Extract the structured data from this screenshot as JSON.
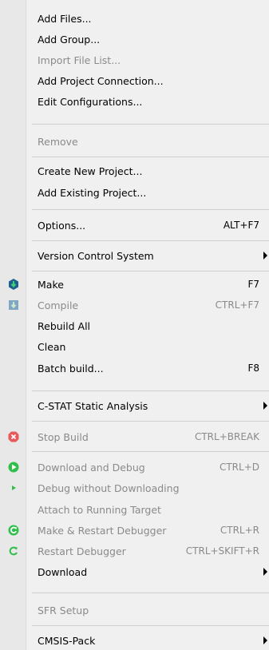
{
  "menu": {
    "items": [
      {
        "label": "Add Files...",
        "enabled": true
      },
      {
        "label": "Add Group...",
        "enabled": true
      },
      {
        "label": "Import File List...",
        "enabled": false
      },
      {
        "label": "Add Project Connection...",
        "enabled": true
      },
      {
        "label": "Edit Configurations...",
        "enabled": true
      },
      {
        "label": "Remove",
        "enabled": false
      },
      {
        "label": "Create New Project...",
        "enabled": true
      },
      {
        "label": "Add Existing Project...",
        "enabled": true
      },
      {
        "label": "Options...",
        "shortcut": "ALT+F7",
        "enabled": true
      },
      {
        "label": "Version Control System",
        "submenu": true,
        "enabled": true
      },
      {
        "label": "Make",
        "shortcut": "F7",
        "icon": "make-icon",
        "enabled": true
      },
      {
        "label": "Compile",
        "shortcut": "CTRL+F7",
        "icon": "compile-icon",
        "enabled": false
      },
      {
        "label": "Rebuild All",
        "enabled": true
      },
      {
        "label": "Clean",
        "enabled": true
      },
      {
        "label": "Batch build...",
        "shortcut": "F8",
        "enabled": true
      },
      {
        "label": "C-STAT Static Analysis",
        "submenu": true,
        "enabled": true
      },
      {
        "label": "Stop Build",
        "shortcut": "CTRL+BREAK",
        "icon": "stop-build-icon",
        "enabled": false
      },
      {
        "label": "Download and Debug",
        "shortcut": "CTRL+D",
        "icon": "download-debug-icon",
        "enabled": false
      },
      {
        "label": "Debug without Downloading",
        "icon": "debug-no-download-icon",
        "enabled": false
      },
      {
        "label": "Attach to Running Target",
        "enabled": false
      },
      {
        "label": "Make & Restart Debugger",
        "shortcut": "CTRL+R",
        "icon": "make-restart-icon",
        "enabled": false
      },
      {
        "label": "Restart Debugger",
        "shortcut": "CTRL+SKIFT+R",
        "icon": "restart-icon",
        "enabled": false
      },
      {
        "label": "Download",
        "submenu": true,
        "enabled": true
      },
      {
        "label": "SFR Setup",
        "enabled": false
      },
      {
        "label": "CMSIS-Pack",
        "submenu": true,
        "enabled": true
      }
    ]
  },
  "colors": {
    "make": "#1f5f8b",
    "compile": "#7fa7c4",
    "stop": "#e65a5a",
    "green": "#2fbf4a",
    "disabled_text": "#8a8a8a"
  }
}
